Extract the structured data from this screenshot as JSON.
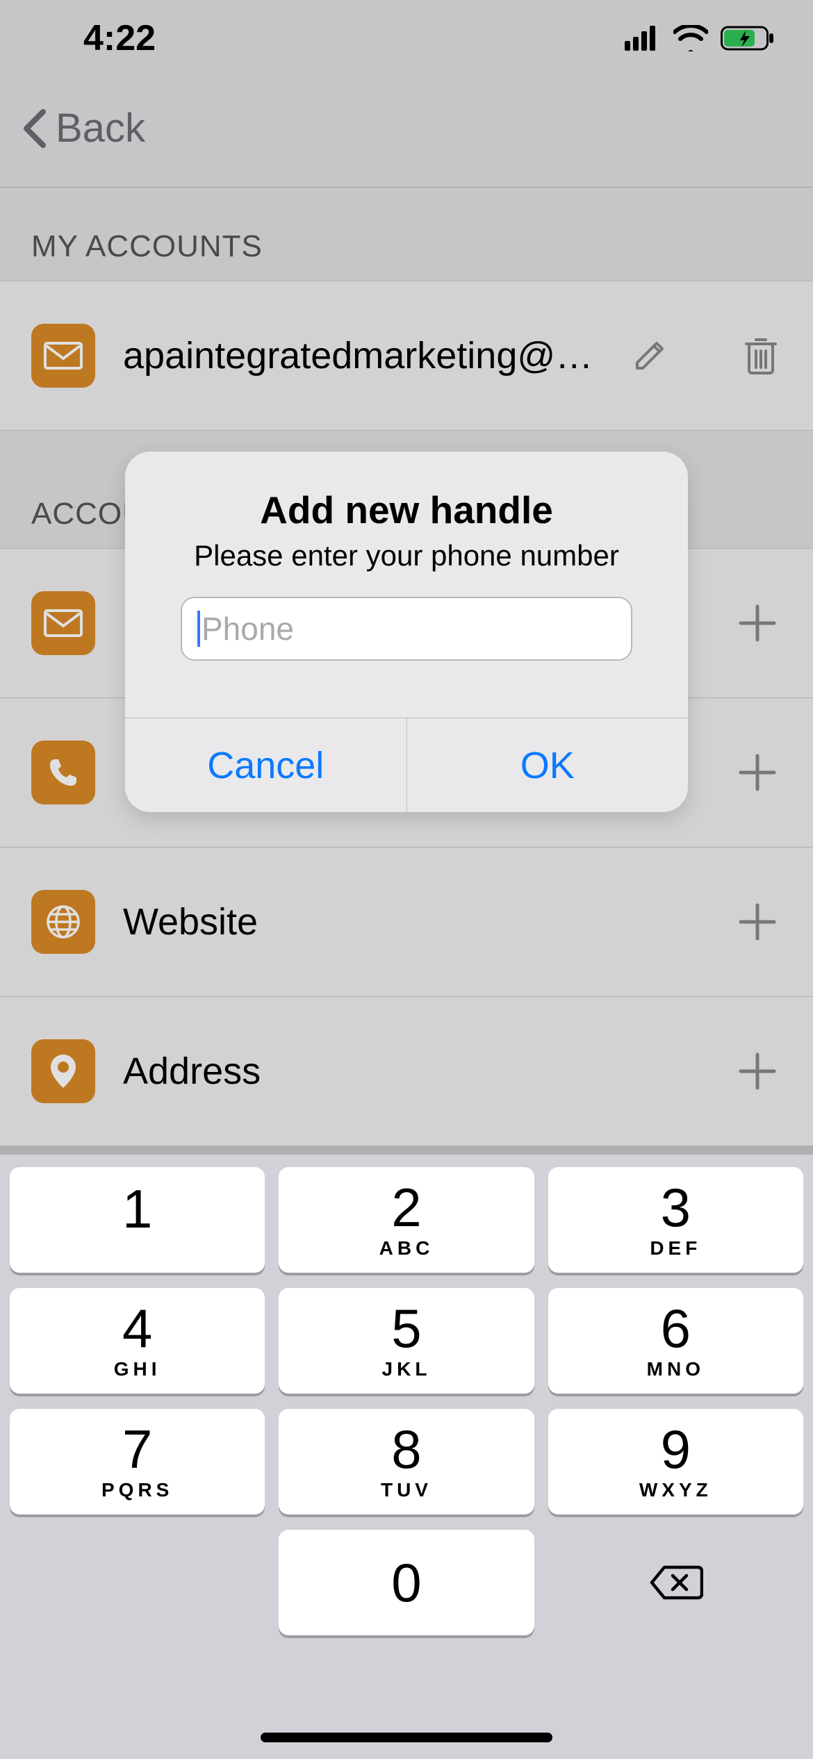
{
  "statusbar": {
    "time": "4:22"
  },
  "navbar": {
    "back_label": "Back"
  },
  "sections": {
    "my_accounts_header": "MY ACCOUNTS",
    "account_types_header": "ACCOUNT TYPES"
  },
  "my_accounts": [
    {
      "type": "email",
      "label": "apaintegratedmarketing@gmail.c…"
    }
  ],
  "account_types": [
    {
      "icon": "mail",
      "label": ""
    },
    {
      "icon": "phone",
      "label": ""
    },
    {
      "icon": "globe",
      "label": "Website"
    },
    {
      "icon": "pin",
      "label": "Address"
    }
  ],
  "alert": {
    "title": "Add new handle",
    "message": "Please enter your phone number",
    "placeholder": "Phone",
    "cancel": "Cancel",
    "ok": "OK"
  },
  "keypad": {
    "keys": [
      {
        "d": "1",
        "s": ""
      },
      {
        "d": "2",
        "s": "ABC"
      },
      {
        "d": "3",
        "s": "DEF"
      },
      {
        "d": "4",
        "s": "GHI"
      },
      {
        "d": "5",
        "s": "JKL"
      },
      {
        "d": "6",
        "s": "MNO"
      },
      {
        "d": "7",
        "s": "PQRS"
      },
      {
        "d": "8",
        "s": "TUV"
      },
      {
        "d": "9",
        "s": "WXYZ"
      },
      {
        "d": "0",
        "s": ""
      }
    ]
  }
}
